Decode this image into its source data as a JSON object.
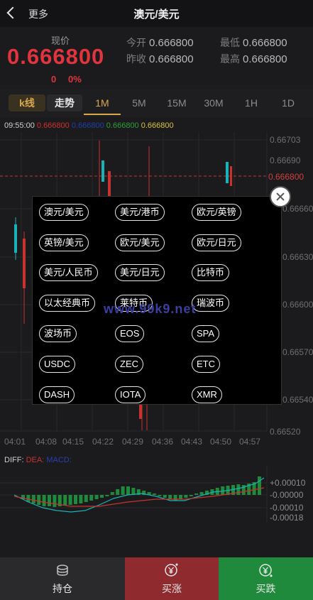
{
  "header": {
    "back_label": "更多",
    "title": "澳元/美元"
  },
  "quote": {
    "price_label": "现价",
    "price": "0.666800",
    "change": "0",
    "change_pct": "0%",
    "open_label": "今开",
    "open": "0.666800",
    "low_label": "最低",
    "low": "0.666800",
    "prev_close_label": "昨收",
    "prev_close": "0.666800",
    "high_label": "最高",
    "high": "0.666800"
  },
  "tabs": [
    "k线",
    "走势",
    "1M",
    "5M",
    "15M",
    "30M",
    "1H",
    "1D"
  ],
  "ma_legend": {
    "time": "09:55:00",
    "v1": "0.666800",
    "v2": "0.666800",
    "v3": "0.666800",
    "v4": "0.666800",
    "c1": "#d32f2f",
    "c2": "#1f3fae",
    "c3": "#2e9e3a",
    "c4": "#d8c23a"
  },
  "chart_axis": {
    "y_labels": [
      "0.66703",
      "0.66690",
      "0.666800",
      "0.66660",
      "0.66630",
      "0.66600",
      "0.66570",
      "0.66540",
      "0.66520"
    ],
    "x_labels": [
      "04:01",
      "04:08",
      "04:15",
      "04:22",
      "04:29",
      "04:36",
      "04:43",
      "04:50",
      "04:57"
    ]
  },
  "macd": {
    "diff_label": "DIFF:",
    "dea_label": "DEA:",
    "macd_label": "MACD:",
    "y_labels": [
      "+0.00010",
      "-0.00000",
      "-0.00010",
      "-0.00018"
    ]
  },
  "popup": {
    "items": [
      "澳元/美元",
      "美元/港币",
      "欧元/英镑",
      "英镑/美元",
      "欧元/美元",
      "欧元/日元",
      "美元/人民币",
      "美元/日元",
      "比特币",
      "以太经典币",
      "莱特币",
      "瑞波币",
      "波场币",
      "EOS",
      "SPA",
      "USDC",
      "ZEC",
      "ETC",
      "DASH",
      "IOTA",
      "XMR"
    ],
    "watermark": "www.99k9.net"
  },
  "bottom": {
    "hold": "持仓",
    "buy_up": "买涨",
    "buy_down": "买跌"
  },
  "colors": {
    "up": "#e0343f",
    "down": "#1f8a3c",
    "accent": "#d9a84a"
  }
}
